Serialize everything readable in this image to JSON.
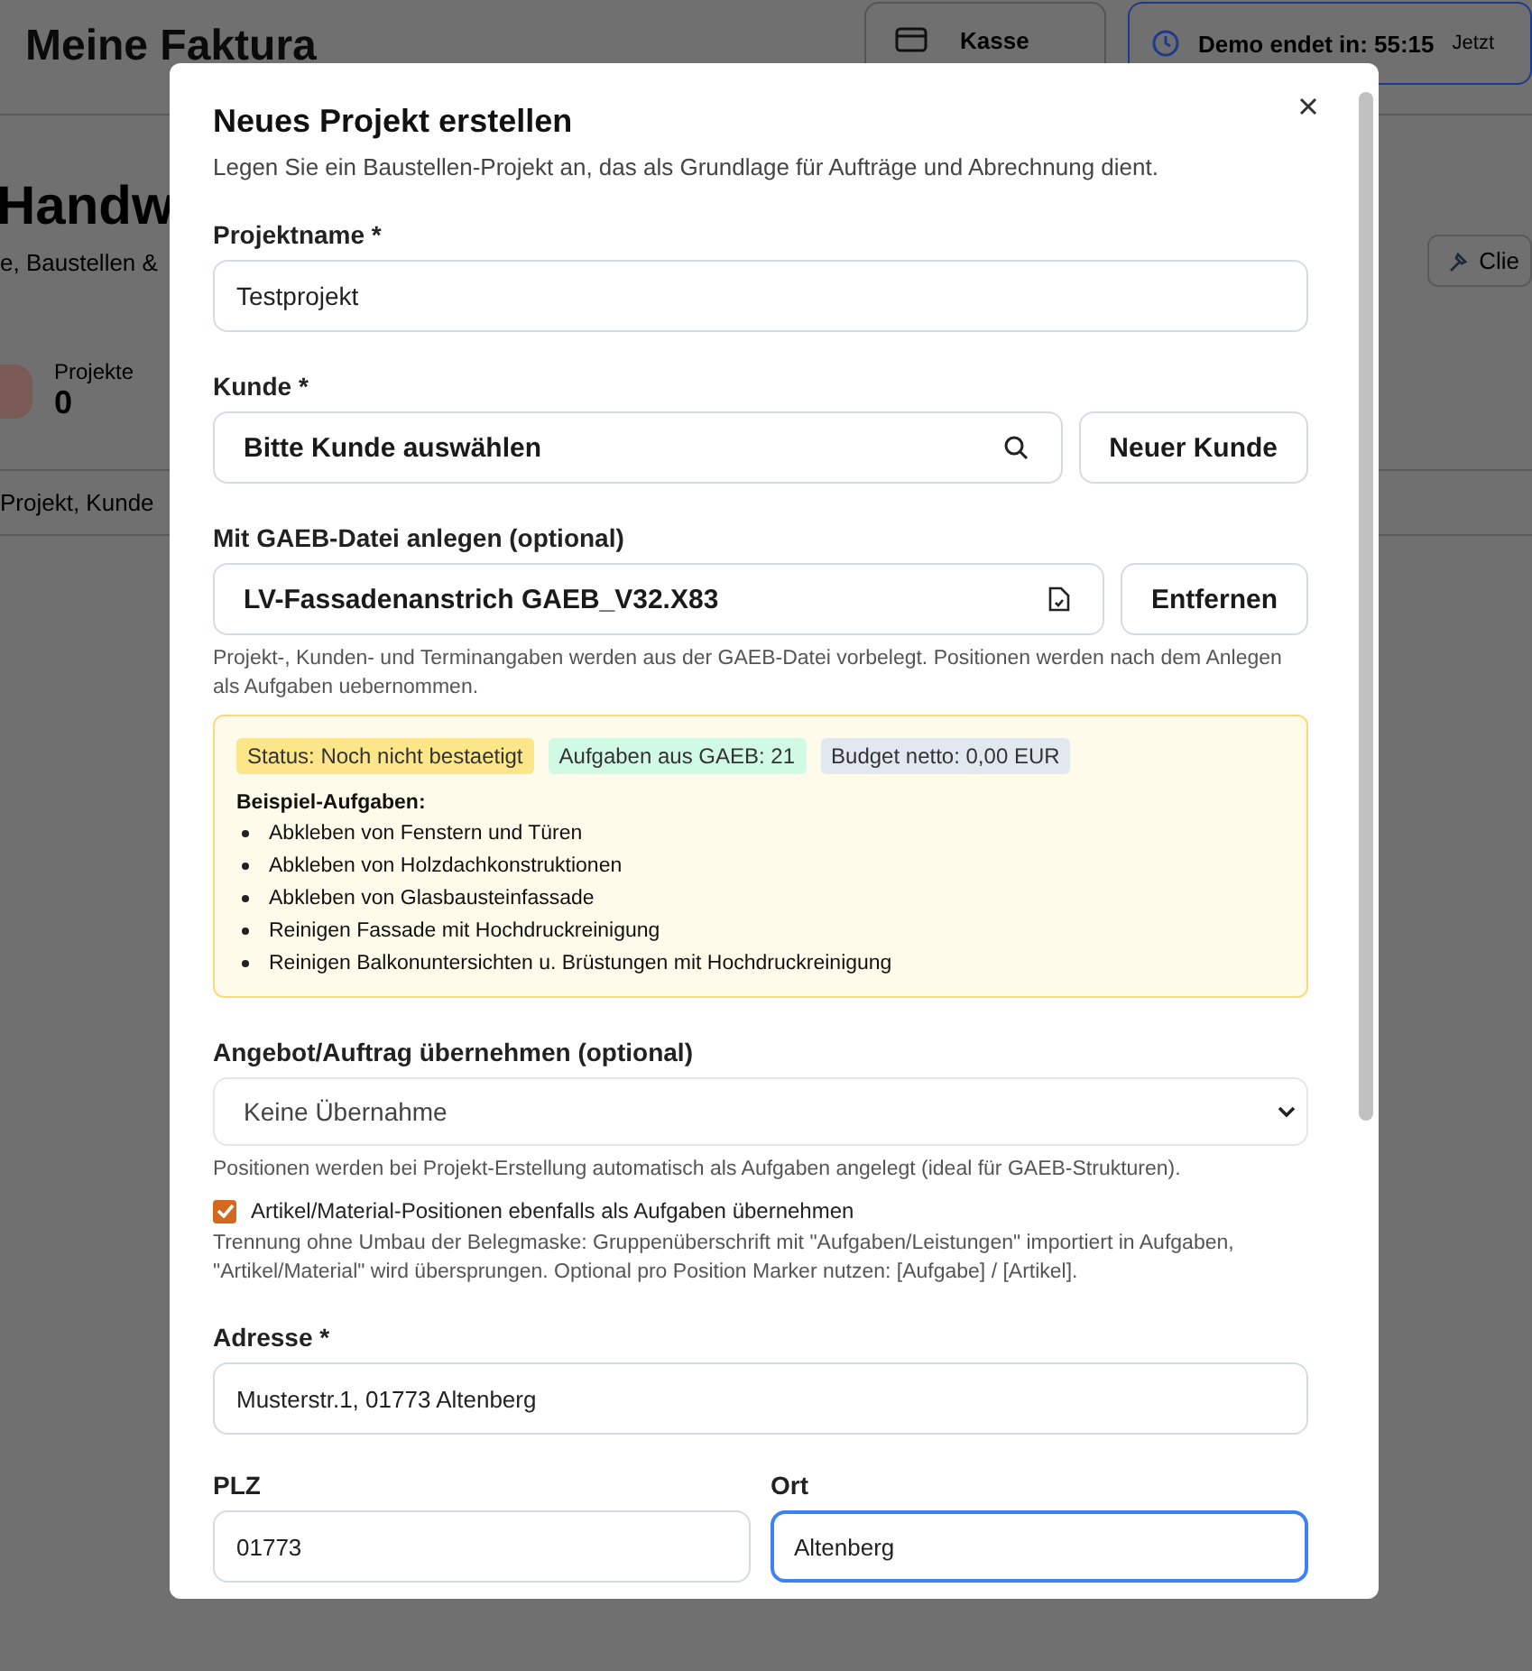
{
  "background": {
    "app_title": "Meine Faktura",
    "kasse_button": "Kasse",
    "demo_timer": "Demo endet in: 55:15",
    "demo_link": "Jetzt",
    "heading": "Handw",
    "subheading": "e, Baustellen &",
    "stat": {
      "label": "Projekte",
      "value": "0"
    },
    "search_placeholder": "Projekt, Kunde",
    "tool_button": "Clie"
  },
  "dialog": {
    "title": "Neues Projekt erstellen",
    "subtitle": "Legen Sie ein Baustellen-Projekt an, das als Grundlage für Aufträge und Abrechnung dient.",
    "project_name": {
      "label": "Projektname *",
      "value": "Testprojekt",
      "focused": false
    },
    "customer": {
      "label": "Kunde *",
      "value": "Bitte Kunde auswählen",
      "button": "Neuer Kunde"
    },
    "gaeb": {
      "label": "Mit GAEB-Datei anlegen (optional)",
      "file_name": "LV-Fassadenanstrich GAEB_V32.X83",
      "remove_button": "Entfernen",
      "help": "Projekt-, Kunden- und Terminangaben werden aus der GAEB-Datei vorbelegt. Positionen werden nach dem Anlegen als Aufgaben uebernommen."
    },
    "gaeb_info": {
      "badges": [
        {
          "text": "Status: Noch nicht bestaetigt",
          "color": "#fde68a"
        },
        {
          "text": "Aufgaben aus GAEB: 21",
          "color": "#d1fae5"
        },
        {
          "text": "Budget netto: 0,00 EUR",
          "color": "#e2e8f0"
        }
      ],
      "examples_title": "Beispiel-Aufgaben:",
      "examples": [
        "Abkleben von Fenstern und Türen",
        "Abkleben von Holzdachkonstruktionen",
        "Abkleben von Glasbausteinfassade",
        "Reinigen Fassade mit Hochdruckreinigung",
        "Reinigen Balkonuntersichten u. Brüstungen mit Hochdruckreinigung"
      ]
    },
    "takeover": {
      "label": "Angebot/Auftrag übernehmen (optional)",
      "value": "Keine Übernahme",
      "help": "Positionen werden bei Projekt-Erstellung automatisch als Aufgaben angelegt (ideal für GAEB-Strukturen).",
      "checkbox": {
        "label": "Artikel/Material-Positionen ebenfalls als Aufgaben übernehmen",
        "checked": true
      },
      "note": "Trennung ohne Umbau der Belegmaske: Gruppenüberschrift mit \"Aufgaben/Leistungen\" importiert in Aufgaben, \"Artikel/Material\" wird übersprungen. Optional pro Position Marker nutzen: [Aufgabe] / [Artikel]."
    },
    "address": {
      "label": "Adresse *",
      "value": "Musterstr.1, 01773 Altenberg",
      "focused": false
    },
    "zip": {
      "label": "PLZ",
      "value": "01773",
      "focused": false
    },
    "city": {
      "label": "Ort",
      "value": "Altenberg",
      "focused": true
    }
  }
}
